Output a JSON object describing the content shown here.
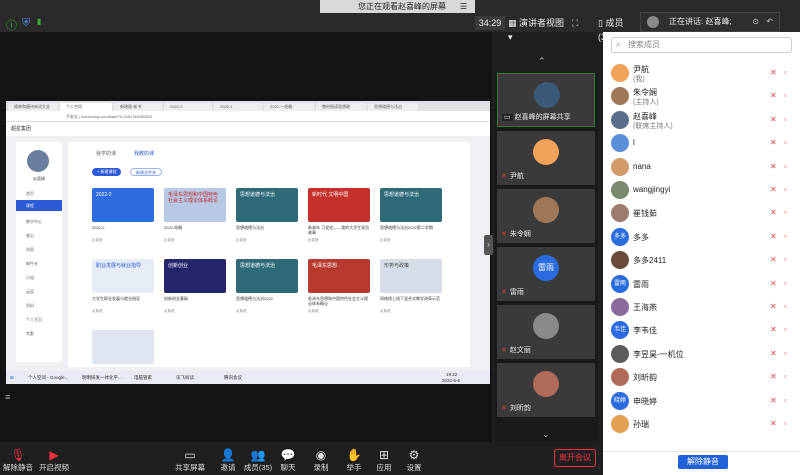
{
  "topbar": {
    "watching_text": "您正在观看赵喜峰的屏幕",
    "menu_glyph": "☰",
    "timer": "34:29",
    "presenter_view_label": "演讲者视图",
    "members_label": "成员(35)",
    "speaking_label": "正在讲话: 赵喜峰;"
  },
  "shared_screen": {
    "tabs": [
      "格林和唐诗宋词大全",
      "个人空间",
      "新增版·新书",
      "2022-2",
      "2022-1",
      "2022-一毛概",
      "教材阅读思想政",
      "思想道德与法治"
    ],
    "address": "不安全 | lichaoxing.com/base?t=1651746450820",
    "site_title": "超星集团",
    "user_name": "赵喜峰",
    "side_items": [
      "首页",
      "课程",
      "教学中心",
      "笔记",
      "消息",
      "邮件夹",
      "小组",
      "云盘",
      "资料",
      "个人主页",
      "考勤"
    ],
    "main_tabs": [
      "我学的课",
      "我教的课"
    ],
    "create_button": "+ 新建课程",
    "folder_button": "新建文件夹",
    "cards": [
      {
        "thumb": "2022-2",
        "caption": "2022-2",
        "sub": "赵喜峰"
      },
      {
        "thumb": "毛泽东思想和中国特色社会主义理论体系概论",
        "caption": "2022-毛概",
        "sub": "赵喜峰"
      },
      {
        "thumb": "思想道德与法治",
        "caption": "思想道德与法治",
        "sub": "赵喜峰"
      },
      {
        "thumb": "新时代 文明中国",
        "caption": "新青年 习党史——我的大学生党员故事",
        "sub": "赵喜峰"
      },
      {
        "thumb": "思想道德与法治",
        "caption": "思想道德与法治2022第二学期",
        "sub": "赵喜峰"
      },
      {
        "thumb": "职业发展与就业指导",
        "caption": "大学生职业发展与就业指导",
        "sub": "赵喜峰"
      },
      {
        "thumb": "创新创业",
        "caption": "创新创业基础",
        "sub": "赵喜峰"
      },
      {
        "thumb": "思想道德与法治",
        "caption": "思想道德与法治2022",
        "sub": "赵喜峰"
      },
      {
        "thumb": "毛泽东思想",
        "caption": "毛泽东思想和中国特色社会主义理论体系概论",
        "sub": "赵喜峰"
      },
      {
        "thumb": "形势与政策",
        "caption": "网络线上线下混合式教学改革示范",
        "sub": "赵喜峰"
      }
    ],
    "taskbar_items": [
      "个人空间 - Google...",
      "明明研发一体化平...",
      "电脑管家",
      "讯飞阅读",
      "腾讯会议"
    ],
    "taskbar_time": "19:22",
    "taskbar_date": "2022-5-5"
  },
  "video_list": [
    {
      "name": "赵喜峰的屏幕共享",
      "share": true
    },
    {
      "name": "尹航"
    },
    {
      "name": "朱令娴"
    },
    {
      "name": "雷雨",
      "avatar_text": "雷雨"
    },
    {
      "name": "赵文丽"
    },
    {
      "name": "刘昕韵"
    }
  ],
  "members_panel": {
    "search_placeholder": "搜索成员",
    "members": [
      {
        "name": "尹航",
        "role": "(我)",
        "color": "#f2a25a"
      },
      {
        "name": "朱令娴",
        "role": "(主持人)",
        "color": "#a07858"
      },
      {
        "name": "赵喜峰",
        "role": "(联席主持人)",
        "color": "#5a6e8c"
      },
      {
        "name": "l",
        "color": "#5a8fd9"
      },
      {
        "name": "nana",
        "color": "#d39b6a"
      },
      {
        "name": "wangjingyi",
        "color": "#7b8a6e"
      },
      {
        "name": "崔钱茹",
        "color": "#9c7c6c"
      },
      {
        "name": "多多",
        "color": "#2a6be0",
        "avatar_text": "多多"
      },
      {
        "name": "多多2411",
        "color": "#6a4b3a"
      },
      {
        "name": "雷雨",
        "color": "#2a6be0",
        "avatar_text": "雷雨"
      },
      {
        "name": "王海燕",
        "color": "#8a6a9a"
      },
      {
        "name": "李韦佳",
        "color": "#2a6be0",
        "avatar_text": "韦佳"
      },
      {
        "name": "李昱昊-一机位",
        "color": "#5c5c5c"
      },
      {
        "name": "刘昕韵",
        "color": "#b06a5a"
      },
      {
        "name": "申晓婷",
        "color": "#2a6be0",
        "avatar_text": "晓婷"
      },
      {
        "name": "孙瑞",
        "color": "#e0a050"
      }
    ],
    "mute_all": "解除静音"
  },
  "bottom_toolbar": {
    "unmute": "解除静音",
    "video": "开启视频",
    "share": "共享屏幕",
    "invite": "邀请",
    "members": "成员(35)",
    "chat": "聊天",
    "record": "录制",
    "raise_hand": "举手",
    "apps": "应用",
    "settings": "设置",
    "leave": "离开会议"
  }
}
